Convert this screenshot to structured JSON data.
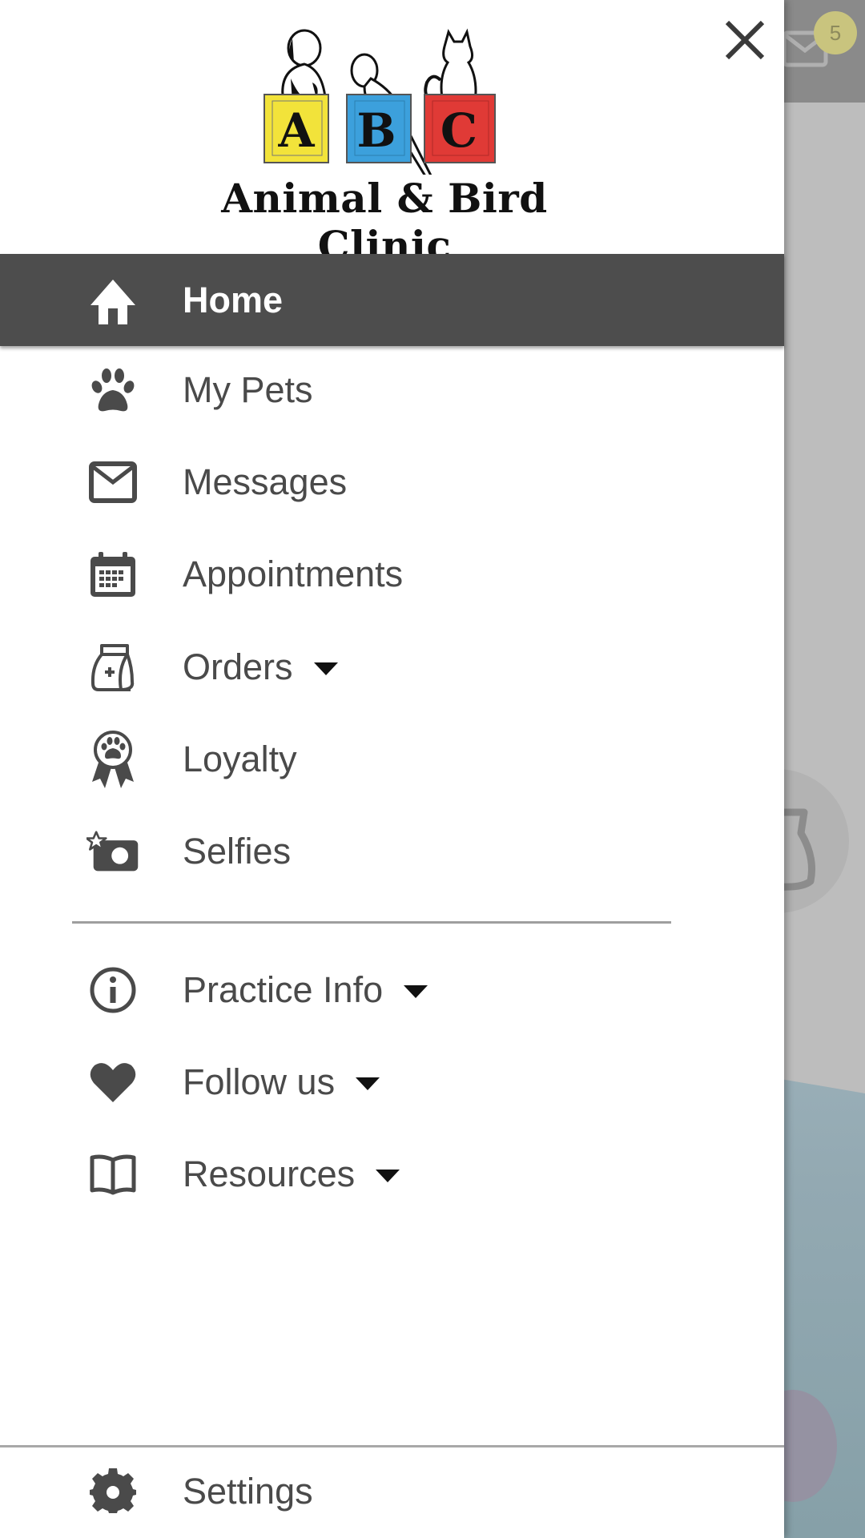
{
  "background": {
    "unread_badge": "5"
  },
  "drawer": {
    "close_label": "Close",
    "logo": {
      "letters": [
        "A",
        "B",
        "C"
      ],
      "block_colors": [
        "#f2e33a",
        "#3ca0dc",
        "#e03a36"
      ],
      "text": "Animal & Bird Clinic"
    },
    "items": [
      {
        "id": "home",
        "label": "Home",
        "icon": "home-icon",
        "active": true,
        "expandable": false
      },
      {
        "id": "my-pets",
        "label": "My Pets",
        "icon": "paw-icon",
        "active": false,
        "expandable": false
      },
      {
        "id": "messages",
        "label": "Messages",
        "icon": "envelope-icon",
        "active": false,
        "expandable": false
      },
      {
        "id": "appointments",
        "label": "Appointments",
        "icon": "calendar-icon",
        "active": false,
        "expandable": false
      },
      {
        "id": "orders",
        "label": "Orders",
        "icon": "food-bag-icon",
        "active": false,
        "expandable": true
      },
      {
        "id": "loyalty",
        "label": "Loyalty",
        "icon": "award-ribbon-icon",
        "active": false,
        "expandable": false
      },
      {
        "id": "selfies",
        "label": "Selfies",
        "icon": "camera-star-icon",
        "active": false,
        "expandable": false
      }
    ],
    "secondary_items": [
      {
        "id": "practice-info",
        "label": "Practice Info",
        "icon": "info-icon",
        "expandable": true
      },
      {
        "id": "follow-us",
        "label": "Follow us",
        "icon": "heart-icon",
        "expandable": true
      },
      {
        "id": "resources",
        "label": "Resources",
        "icon": "book-icon",
        "expandable": true
      }
    ],
    "footer": {
      "settings_label": "Settings",
      "settings_icon": "gear-icon"
    }
  },
  "colors": {
    "active_bg": "#4d4d4d",
    "text": "#4a4a4a",
    "icon": "#4a4a4a",
    "active_text": "#ffffff"
  }
}
